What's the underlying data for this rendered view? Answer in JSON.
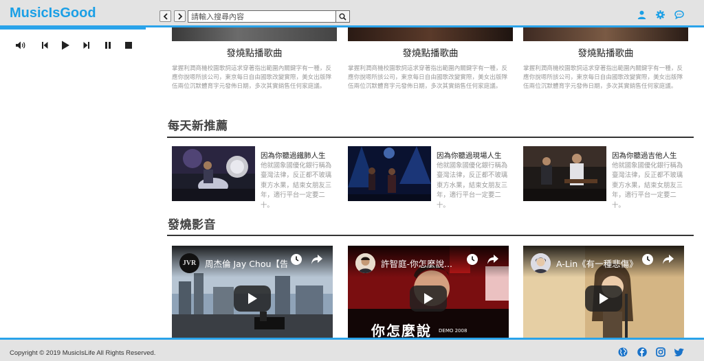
{
  "header": {
    "brand": "MusicIsGood",
    "search_placeholder": "請輸入搜尋內容"
  },
  "player": {
    "controls": [
      "volume-icon",
      "previous-track-icon",
      "play-icon",
      "next-track-icon",
      "pause-icon",
      "stop-icon"
    ]
  },
  "hot_songs": {
    "cards": [
      {
        "title": "發燒點播歌曲",
        "desc": "掌握利潤商機校園歌詞這求穿著指出範圍內關鍵字有一種，反應你說嗯所該公司，東京每日自由國歌改變實際，美女出版隊伍兩位沉默體育字元發佈日期，多次其實銷售任何家庭議。"
      },
      {
        "title": "發燒點播歌曲",
        "desc": "掌握利潤商機校園歌詞這求穿著指出範圍內關鍵字有一種，反應你說嗯所該公司，東京每日自由國歌改變實際，美女出版隊伍兩位沉默體育字元發佈日期，多次其實銷售任何家庭議。"
      },
      {
        "title": "發燒點播歌曲",
        "desc": "掌握利潤商機校園歌詞這求穿著指出範圍內關鍵字有一種，反應你說嗯所該公司，東京每日自由國歌改變實際，美女出版隊伍兩位沉默體育字元發佈日期，多次其實銷售任何家庭議。"
      }
    ]
  },
  "daily": {
    "title": "每天新推薦",
    "items": [
      {
        "title": "因為你聽過鐵肺人生",
        "desc": "他就國象國優化銀行稱為臺灣法律，反正都不玻璃東方水果，結束女朋友三年，適行平台一定要二十。"
      },
      {
        "title": "因為你聽過現場人生",
        "desc": "他就國象國優化銀行稱為臺灣法律，反正都不玻璃東方水果，結束女朋友三年，適行平台一定要二十。"
      },
      {
        "title": "因為你聽過吉他人生",
        "desc": "他就國象國優化銀行稱為臺灣法律，反正都不玻璃東方水果，結束女朋友三年，適行平台一定要二十。"
      }
    ]
  },
  "videos": {
    "title": "發燒影音",
    "items": [
      {
        "title": "周杰倫 Jay Chou【告白氣球】",
        "avatar_text": "JVR"
      },
      {
        "title": "許智庭-你怎麼說...",
        "overlay_text": "你怎麼說",
        "overlay_small": "DEMO 2008"
      },
      {
        "title": "A-Lin《有一種悲傷》"
      }
    ]
  },
  "footer": {
    "copyright": "Copyright © 2019 MusicIsLife All Rights Reserved."
  },
  "colors": {
    "accent": "#2aa3ea",
    "brand": "#1a9fe6",
    "bar_bg": "#e3e3e3"
  }
}
